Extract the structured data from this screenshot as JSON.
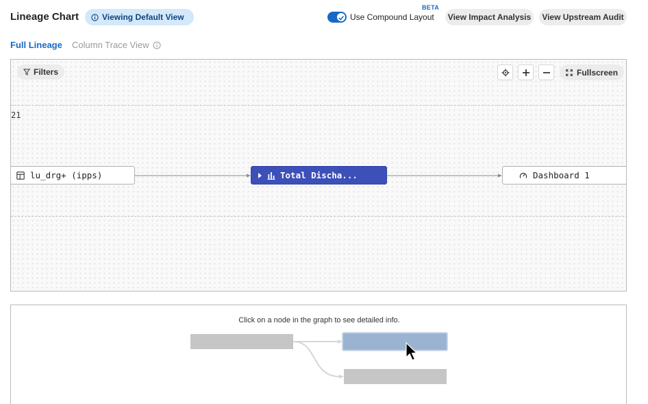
{
  "header": {
    "title": "Lineage Chart",
    "view_pill": "Viewing Default View",
    "compound_layout_label": "Use Compound Layout",
    "compound_layout_on": true,
    "beta_badge": "BETA",
    "impact_button": "View Impact Analysis",
    "upstream_button": "View Upstream Audit"
  },
  "tabs": {
    "full_lineage": "Full Lineage",
    "column_trace": "Column Trace View"
  },
  "chart": {
    "filters_label": "Filters",
    "fullscreen_label": "Fullscreen",
    "level_label": "21",
    "nodes": {
      "source": "lu_drg+ (ipps)",
      "selected": "Total Discha...",
      "dashboard": "Dashboard 1"
    }
  },
  "info_panel": {
    "text": "Click on a node in the graph to see detailed info."
  },
  "colors": {
    "accent": "#1769c7",
    "selected_node": "#3d4fb8",
    "pill_bg": "#d3e8fa",
    "button_bg": "#ececec"
  }
}
